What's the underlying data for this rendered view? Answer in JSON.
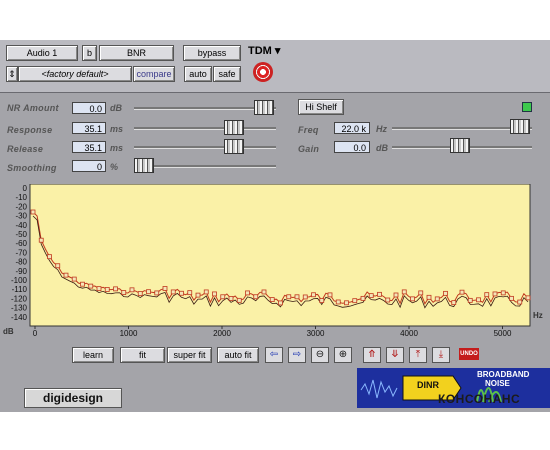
{
  "header": {
    "track_name": "Audio 1",
    "insert_slot": "b",
    "plugin_name": "BNR",
    "bypass_label": "bypass",
    "platform": "TDM",
    "preset": "<factory default>",
    "compare_label": "compare",
    "auto_label": "auto",
    "safe_label": "safe"
  },
  "params": {
    "nr_amount": {
      "label": "NR Amount",
      "value": "0.0",
      "unit": "dB"
    },
    "response": {
      "label": "Response",
      "value": "35.1",
      "unit": "ms"
    },
    "release": {
      "label": "Release",
      "value": "35.1",
      "unit": "ms"
    },
    "smoothing": {
      "label": "Smoothing",
      "value": "0",
      "unit": "%"
    },
    "hi_shelf_label": "Hi Shelf",
    "freq": {
      "label": "Freq",
      "value": "22.0 k",
      "unit": "Hz"
    },
    "gain": {
      "label": "Gain",
      "value": "0.0",
      "unit": "dB"
    }
  },
  "graph": {
    "y_ticks": [
      "0",
      "-10",
      "-20",
      "-30",
      "-40",
      "-50",
      "-60",
      "-70",
      "-80",
      "-90",
      "-100",
      "-110",
      "-120",
      "-130",
      "-140"
    ],
    "y_unit": "dB",
    "x_ticks": [
      "0",
      "1000",
      "2000",
      "3000",
      "4000",
      "5000"
    ],
    "x_unit": "Hz",
    "plot_bg": "#faf1a7",
    "curve_color": "#c0391e"
  },
  "controls": {
    "learn": "learn",
    "fit": "fit",
    "super_fit": "super fit",
    "auto_fit": "auto fit",
    "undo": "UNDO"
  },
  "footer": {
    "logo": "digidesign",
    "brand_top": "BROADBAND",
    "brand_mid": "NOISE",
    "brand_small": "DINR",
    "watermark": "КОНСОНАНС"
  }
}
